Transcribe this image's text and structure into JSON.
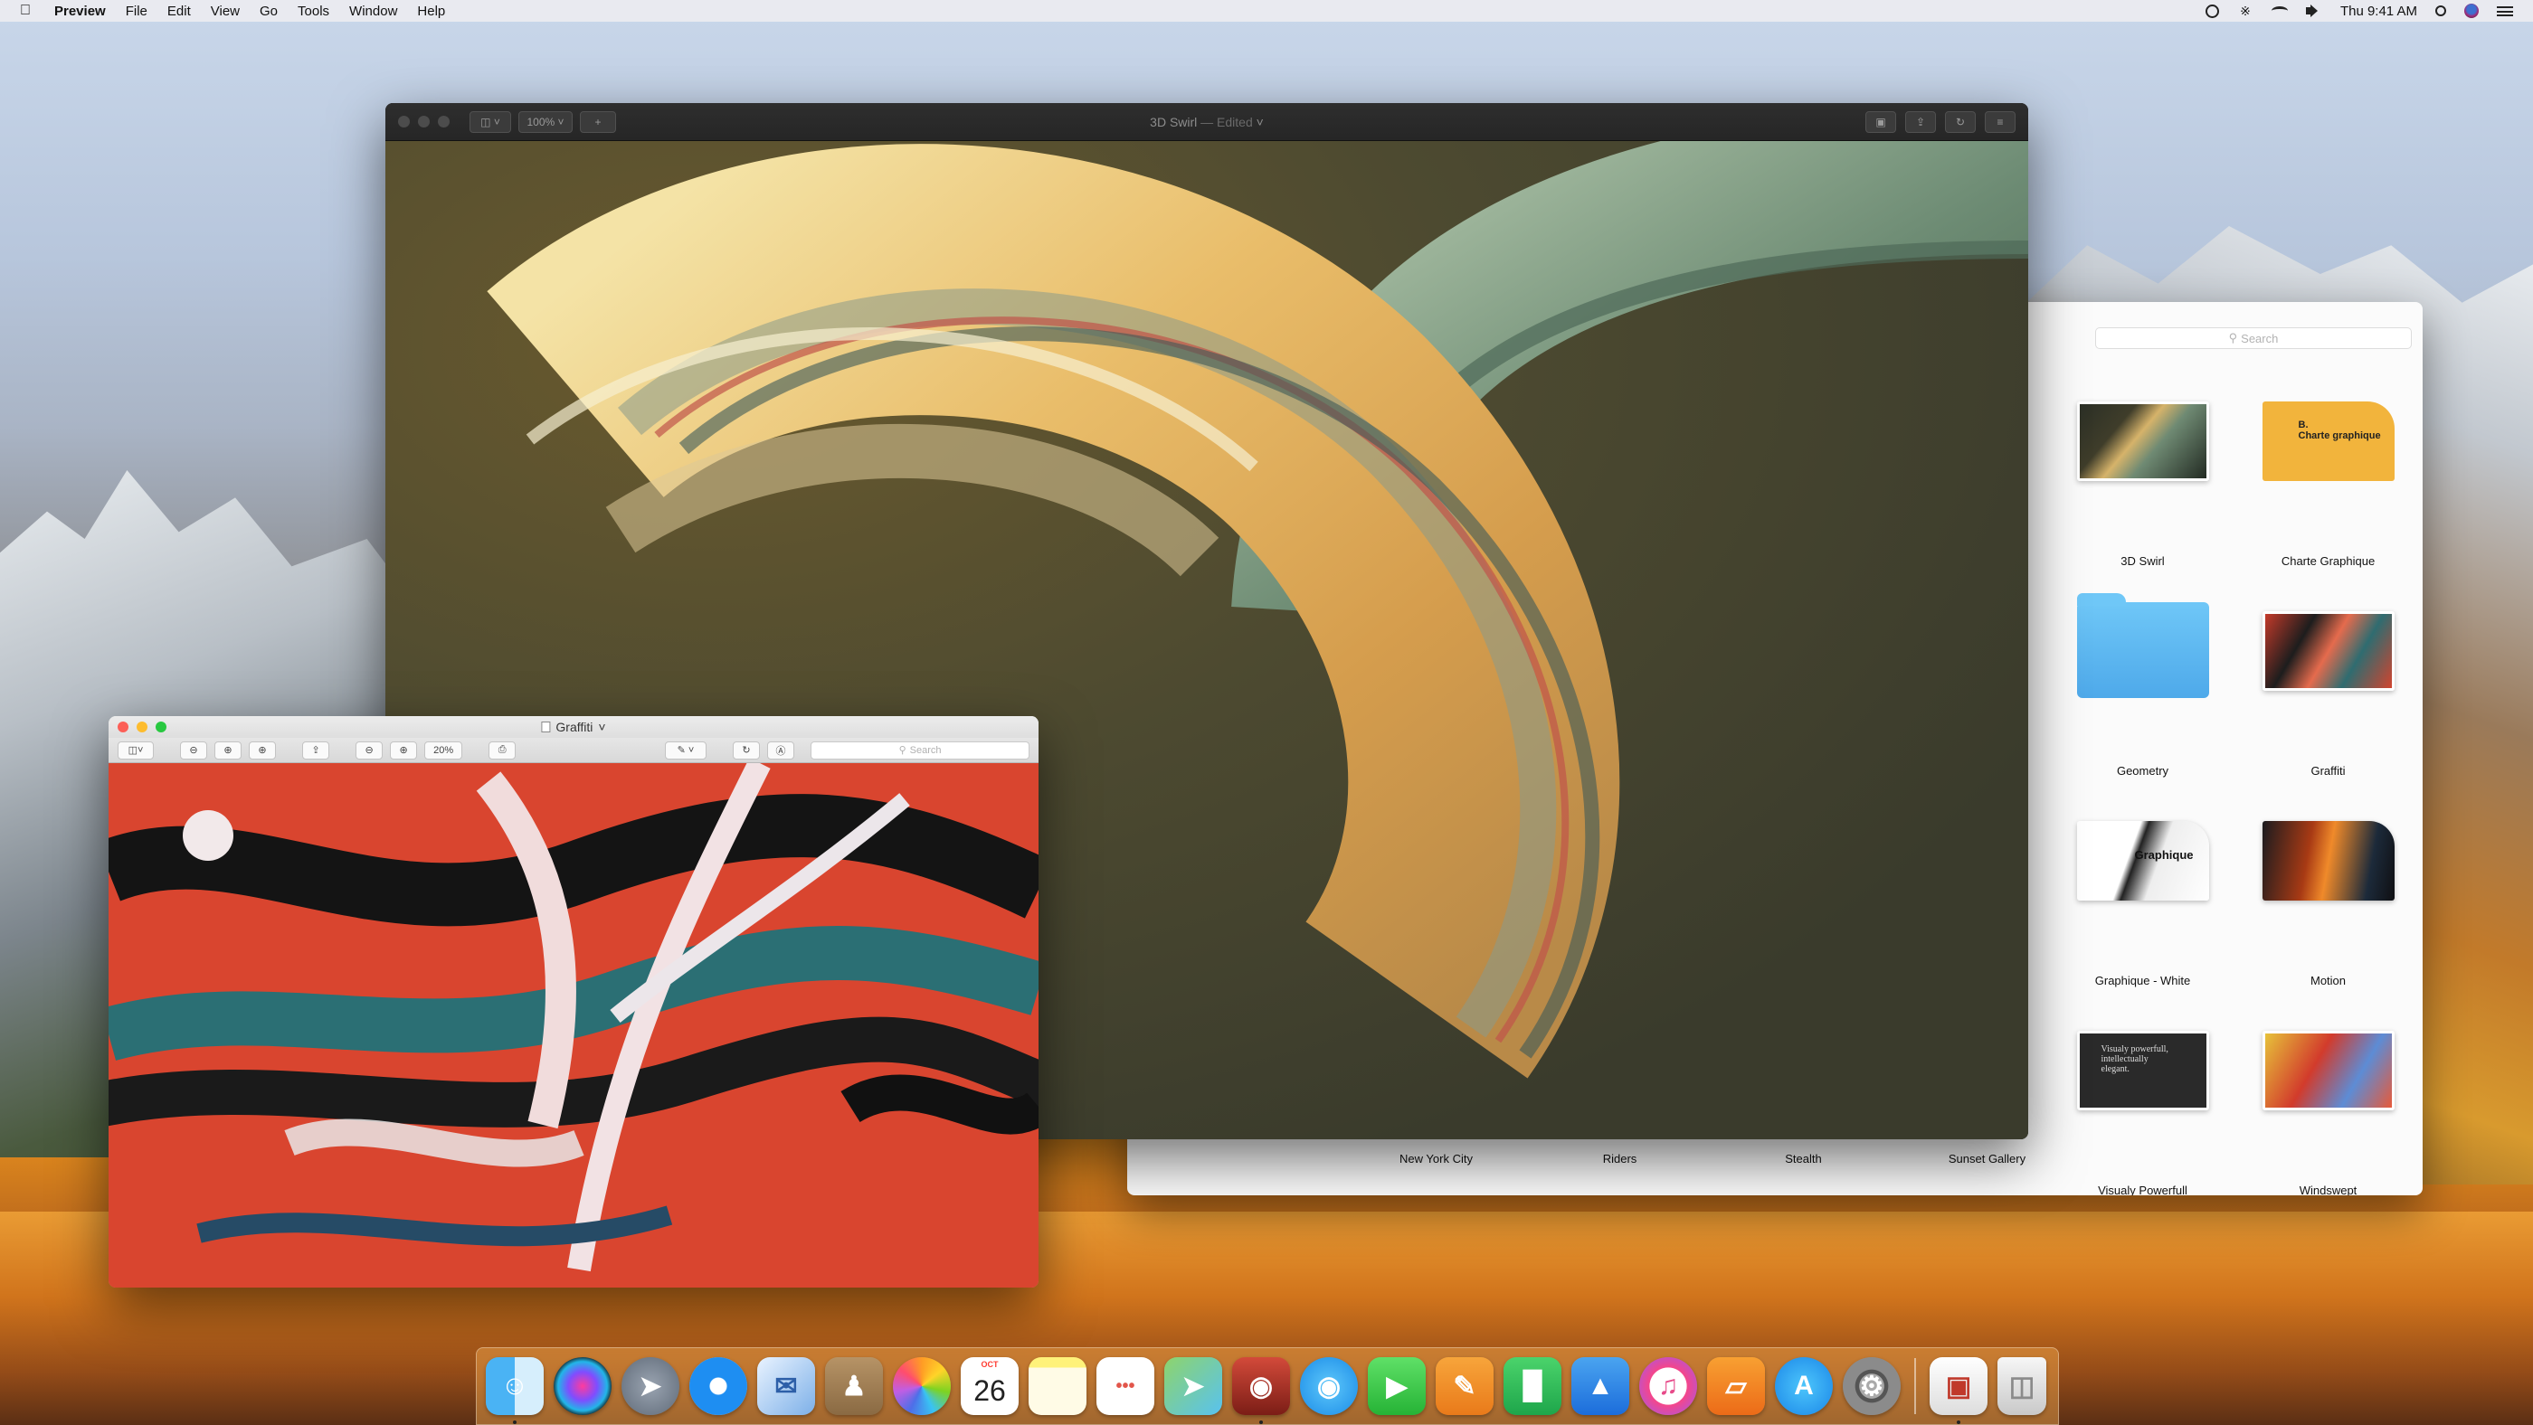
{
  "menubar": {
    "app_name": "Preview",
    "menus": [
      "File",
      "Edit",
      "View",
      "Go",
      "Tools",
      "Window",
      "Help"
    ],
    "clock": "Thu 9:41 AM",
    "icons": [
      "time-machine-icon",
      "bluetooth-icon",
      "wifi-icon",
      "volume-icon",
      "spotlight-icon",
      "user-icon",
      "notification-center-icon"
    ]
  },
  "main_window": {
    "title": "3D Swirl",
    "title_suffix": "— Edited",
    "zoom": "100%",
    "sidebar_toggle_icon": "sidebar-icon",
    "add_icon": "plus-icon"
  },
  "browser": {
    "search_placeholder": "Search",
    "tiles": [
      {
        "label": "3D Swirl",
        "kind": "swirl"
      },
      {
        "label": "Charte Graphique",
        "kind": "doc-yellow",
        "thumb_text": "B.\nCharte graphique"
      },
      {
        "label": "Geometry",
        "kind": "folder"
      },
      {
        "label": "Graffiti",
        "kind": "graffiti"
      },
      {
        "label": "Graphique - White",
        "kind": "graphique",
        "thumb_text": "Graphique"
      },
      {
        "label": "Motion",
        "kind": "motion"
      },
      {
        "label": "Visualy Powerfull",
        "kind": "visually",
        "thumb_text": "Visualy powerfull, intellectually elegant."
      },
      {
        "label": "Windswept",
        "kind": "windswept"
      }
    ],
    "bottom_labels": [
      "New York City",
      "Riders",
      "Stealth",
      "Sunset Gallery"
    ]
  },
  "graffiti_window": {
    "title": "Graffiti",
    "zoom": "20%",
    "search_placeholder": "Search"
  },
  "dock": {
    "calendar_month": "OCT",
    "calendar_day": "26",
    "apps": [
      "Finder",
      "Siri",
      "Launchpad",
      "Safari",
      "Mail",
      "Contacts",
      "Photos",
      "Calendar",
      "Notes",
      "Reminders",
      "Maps",
      "Photo Booth",
      "Messages",
      "FaceTime",
      "Pages",
      "Numbers",
      "Keynote",
      "iTunes",
      "iBooks",
      "App Store",
      "System Preferences",
      "Preview",
      "Trash"
    ]
  },
  "colors": {
    "menubar_bg": "#ececf0",
    "accent_blue": "#1e8ef2",
    "graffiti_red": "#d9452f",
    "swirl_gold": "#e6b760",
    "swirl_green": "#7f9b83"
  }
}
